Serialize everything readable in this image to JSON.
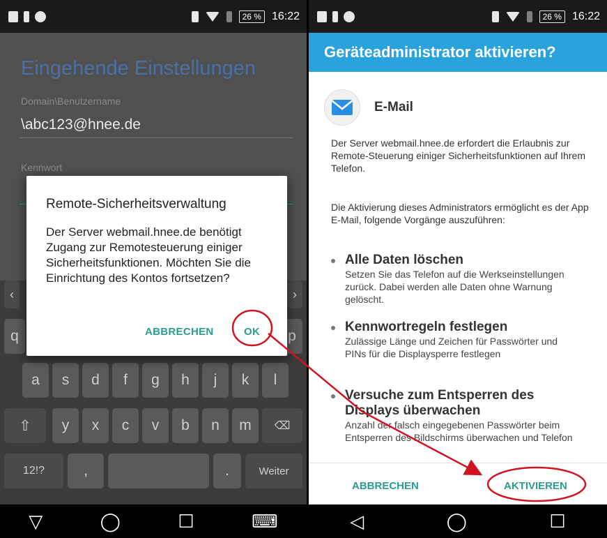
{
  "left": {
    "status": {
      "battery": "26 %",
      "time": "16:22"
    },
    "page_title": "Eingehende Einstellungen",
    "username_label": "Domain\\Benutzername",
    "username_value": "\\abc123@hnee.de",
    "password_label": "Kennwort",
    "keyboard": {
      "row2": [
        "a",
        "s",
        "d",
        "f",
        "g",
        "h",
        "j",
        "k",
        "l"
      ],
      "row3": [
        "y",
        "x",
        "c",
        "v",
        "b",
        "n",
        "m"
      ],
      "row1_partial": [
        "q",
        "p"
      ],
      "sym_label": "12!?",
      "comma_label": ",",
      "period_label": ".",
      "enter_label": "Weiter"
    },
    "dialog": {
      "title": "Remote-Sicherheitsverwaltung",
      "message": "Der Server webmail.hnee.de benötigt Zugang zur Remotesteuerung einiger Sicherheitsfunktionen. Möchten Sie die Einrichtung des Kontos fortsetzen?",
      "cancel": "ABBRECHEN",
      "ok": "OK"
    },
    "nav": {
      "back": "▽",
      "home": "◯",
      "recents": "☐",
      "keyboard": "⌨"
    }
  },
  "right": {
    "status": {
      "battery": "26 %",
      "time": "16:22"
    },
    "title": "Geräteadministrator aktivieren?",
    "app_name": "E-Mail",
    "intro": "Der Server webmail.hnee.de erfordert die Erlaubnis zur Remote-Steuerung einiger Sicherheitsfunktionen auf Ihrem Telefon.",
    "activation_text": "Die Aktivierung dieses Administrators ermöglicht es der App E-Mail, folgende Vorgänge auszuführen:",
    "permissions": [
      {
        "title": "Alle Daten löschen",
        "desc": "Setzen Sie das Telefon auf die Werkseinstellungen zurück. Dabei werden alle Daten ohne Warnung gelöscht."
      },
      {
        "title": "Kennwortregeln festlegen",
        "desc": "Zulässige Länge und Zeichen für Passwörter und PINs für die Displaysperre festlegen"
      },
      {
        "title": "Versuche zum Entsperren des Displays überwachen",
        "desc": "Anzahl der falsch eingegebenen Passwörter beim Entsperren des Bildschirms überwachen und Telefon"
      }
    ],
    "cancel": "ABBRECHEN",
    "activate": "AKTIVIEREN",
    "nav": {
      "back": "◁",
      "home": "◯",
      "recents": "☐"
    }
  },
  "annotation_color": "#d0141f"
}
